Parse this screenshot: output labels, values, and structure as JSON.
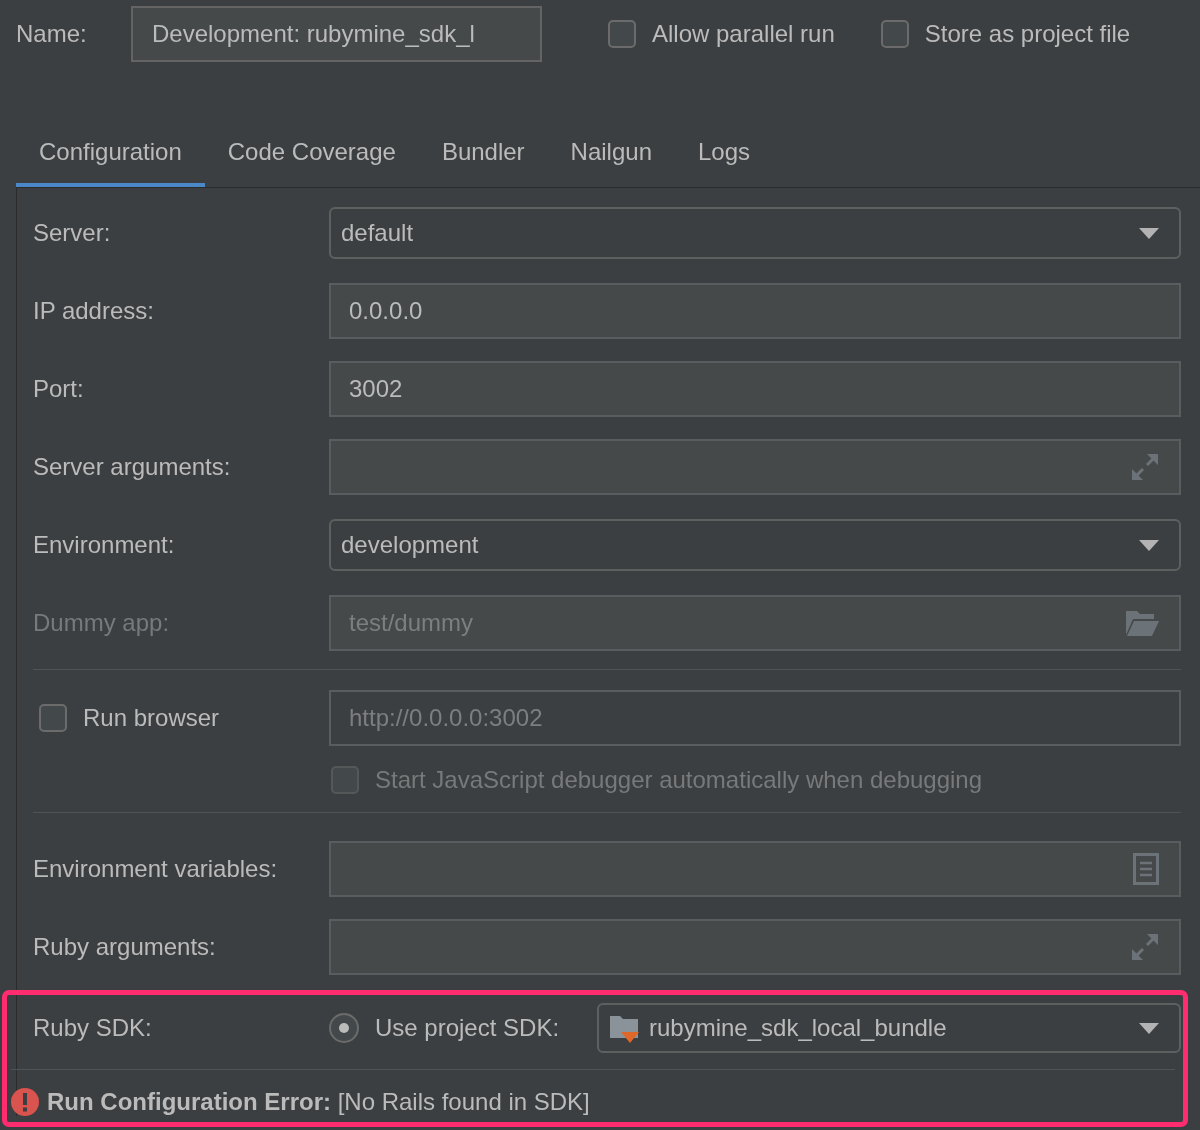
{
  "name_field": {
    "label": "Name:",
    "value": "Development: rubymine_sdk_l"
  },
  "options": [
    {
      "label": "Allow parallel run",
      "checked": false
    },
    {
      "label": "Store as project file",
      "checked": false
    }
  ],
  "tabs": [
    {
      "label": "Configuration",
      "selected": true
    },
    {
      "label": "Code Coverage",
      "selected": false
    },
    {
      "label": "Bundler",
      "selected": false
    },
    {
      "label": "Nailgun",
      "selected": false
    },
    {
      "label": "Logs",
      "selected": false
    }
  ],
  "server_rows": [
    {
      "kind": "dropdown",
      "label": "Server:",
      "value": "default",
      "disabled": false
    },
    {
      "kind": "text",
      "label": "IP address:",
      "value": "0.0.0.0",
      "disabled": false
    },
    {
      "kind": "text",
      "label": "Port:",
      "value": "3002",
      "disabled": false
    },
    {
      "kind": "expand",
      "label": "Server arguments:",
      "disabled": false
    },
    {
      "kind": "dropdown",
      "label": "Environment:",
      "value": "development",
      "disabled": false
    },
    {
      "kind": "folder",
      "label": "Dummy app:",
      "value": "test/dummy",
      "disabled": true
    }
  ],
  "run_browser": {
    "label": "Run browser",
    "checked": false,
    "url": "http://0.0.0.0:3002",
    "url_disabled": true
  },
  "js_debugger": {
    "label": "Start JavaScript debugger automatically when debugging",
    "checked": false,
    "disabled": true
  },
  "env_rows": [
    {
      "kind": "notes",
      "label": "Environment variables:",
      "disabled": false
    },
    {
      "kind": "expand",
      "label": "Ruby arguments:",
      "disabled": false
    }
  ],
  "ruby_sdk": {
    "label": "Ruby SDK:",
    "option": {
      "label": "Use project SDK:",
      "selected": true
    },
    "sdk": "rubymine_sdk_local_bundle"
  },
  "error": {
    "message": "**Run Configuration Error:** [No Rails found in SDK]"
  }
}
